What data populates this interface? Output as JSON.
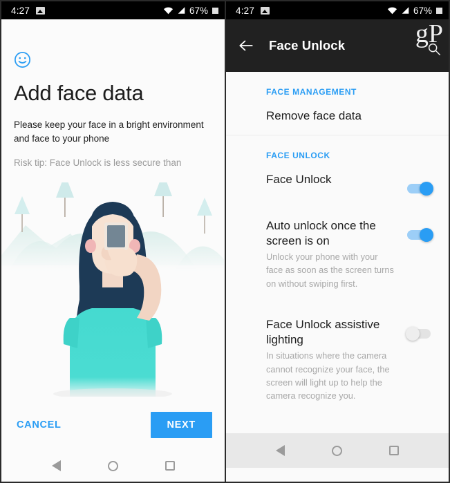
{
  "statusbar": {
    "time": "4:27",
    "battery_percent": "67%",
    "photo_icon": "image-icon",
    "wifi_icon": "wifi-icon",
    "signal_icon": "cell-signal-icon",
    "battery_icon": "battery-icon"
  },
  "left_screen": {
    "face_icon": "smiley-face-icon",
    "title": "Add face data",
    "subtitle": "Please keep your face in a bright environment and face to your phone",
    "risk_tip": "Risk tip: Face Unlock is less secure than",
    "illustration_name": "woman-holding-phone-illustration",
    "cancel_label": "CANCEL",
    "next_label": "NEXT",
    "accent_color": "#2a9df4"
  },
  "right_screen": {
    "back_icon": "back-arrow-icon",
    "title": "Face Unlock",
    "watermark": "gP",
    "watermark_icon": "magnifying-glass-icon",
    "sections": [
      {
        "header": "FACE MANAGEMENT",
        "rows": [
          {
            "title": "Remove face data",
            "desc": "",
            "toggle": null
          }
        ]
      },
      {
        "header": "FACE UNLOCK",
        "rows": [
          {
            "title": "Face Unlock",
            "desc": "",
            "toggle": "on"
          },
          {
            "title": "Auto unlock once the screen is on",
            "desc": "Unlock your phone with your face as soon as the screen turns on without swiping first.",
            "toggle": "on"
          },
          {
            "title": "Face Unlock assistive lighting",
            "desc": "In situations where the camera cannot recognize your face, the screen will light up to help the camera recognize you.",
            "toggle": "off"
          }
        ]
      }
    ],
    "header_color": "#2a9df4",
    "appbar_color": "#212121"
  },
  "navbar": {
    "back_icon": "nav-back-triangle-icon",
    "home_icon": "nav-home-circle-icon",
    "recent_icon": "nav-recents-square-icon"
  }
}
